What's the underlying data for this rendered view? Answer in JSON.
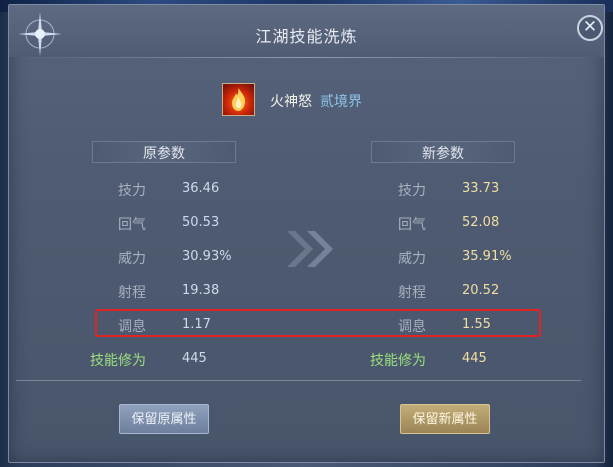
{
  "window": {
    "title": "江湖技能洗炼",
    "close_glyph": "✕"
  },
  "skill": {
    "name": "火神怒",
    "level": "贰境界"
  },
  "headers": {
    "old": "原参数",
    "new": "新参数"
  },
  "stats": [
    {
      "label": "技力",
      "old": "36.46",
      "new": "33.73"
    },
    {
      "label": "回气",
      "old": "50.53",
      "new": "52.08"
    },
    {
      "label": "威力",
      "old": "30.93%",
      "new": "35.91%"
    },
    {
      "label": "射程",
      "old": "19.38",
      "new": "20.52"
    },
    {
      "label": "调息",
      "old": "1.17",
      "new": "1.55"
    }
  ],
  "cultivation": {
    "label": "技能修为",
    "old": "445",
    "new": "445"
  },
  "buttons": {
    "keep_old": "保留原属性",
    "keep_new": "保留新属性"
  },
  "icons": {
    "skill": "fire-skill-icon",
    "arrow": "double-chevron-right-icon",
    "close": "close-icon",
    "decor": "star-compass-icon"
  },
  "colors": {
    "highlight": "#e02424",
    "new_value": "#f1dfa2",
    "cultivation_label": "#9be07d"
  }
}
